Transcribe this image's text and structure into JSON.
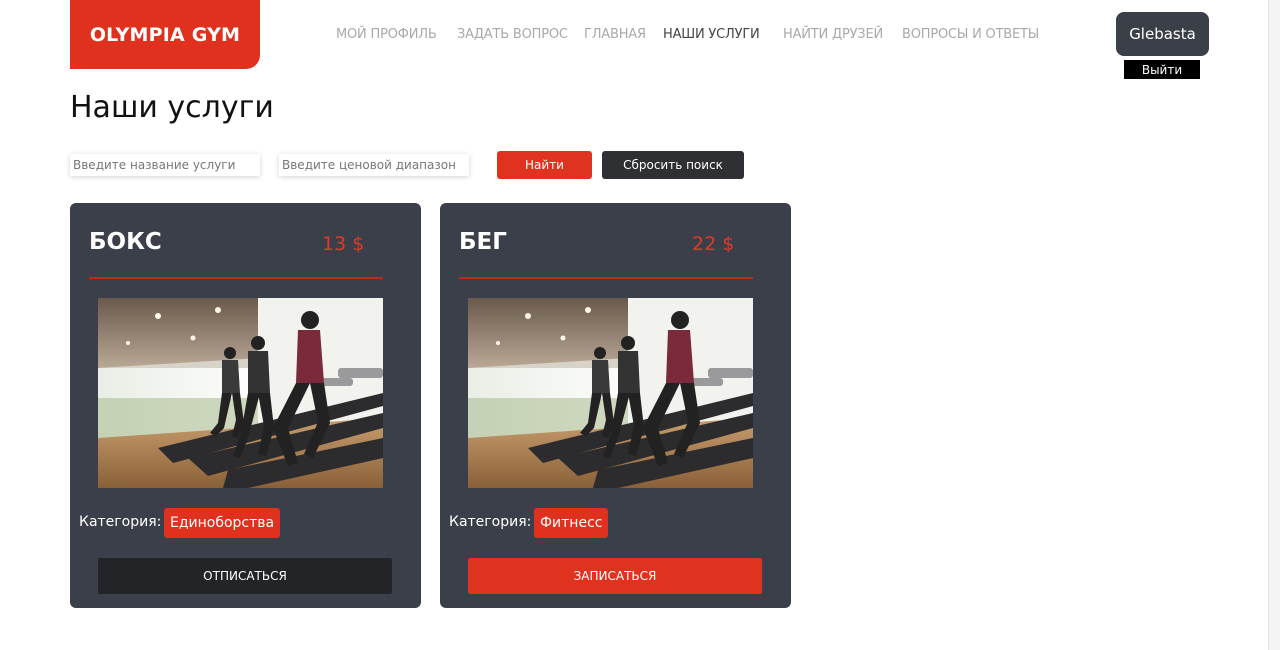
{
  "brand": {
    "name": "OLYMPIA GYM"
  },
  "nav": {
    "items": [
      {
        "label": "МОЙ ПРОФИЛЬ"
      },
      {
        "label": "ЗАДАТЬ ВОПРОС"
      },
      {
        "label": "ГЛАВНАЯ"
      },
      {
        "label": "НАШИ УСЛУГИ"
      },
      {
        "label": "НАЙТИ ДРУЗЕЙ"
      },
      {
        "label": "ВОПРОСЫ И ОТВЕТЫ"
      }
    ],
    "active_index": 3
  },
  "user": {
    "name": "Glebasta",
    "logout_label": "Выйти"
  },
  "page": {
    "title": "Наши услуги"
  },
  "search": {
    "name_placeholder": "Введите название услуги",
    "price_placeholder": "Введите ценовой диапазон",
    "find_label": "Найти",
    "reset_label": "Сбросить поиск"
  },
  "services": [
    {
      "title": "БОКС",
      "price": "13 $",
      "category_label": "Категория:",
      "category": "Единоборства",
      "action_label": "отписаться",
      "subscribed": true,
      "image": "treadmill-runners-photo"
    },
    {
      "title": "БЕГ",
      "price": "22 $",
      "category_label": "Категория:",
      "category": "Фитнесс",
      "action_label": "записаться",
      "subscribed": false,
      "image": "treadmill-runners-photo"
    }
  ],
  "colors": {
    "accent": "#e0311f",
    "card_bg": "#3b3f49",
    "dark_button": "#232427"
  }
}
